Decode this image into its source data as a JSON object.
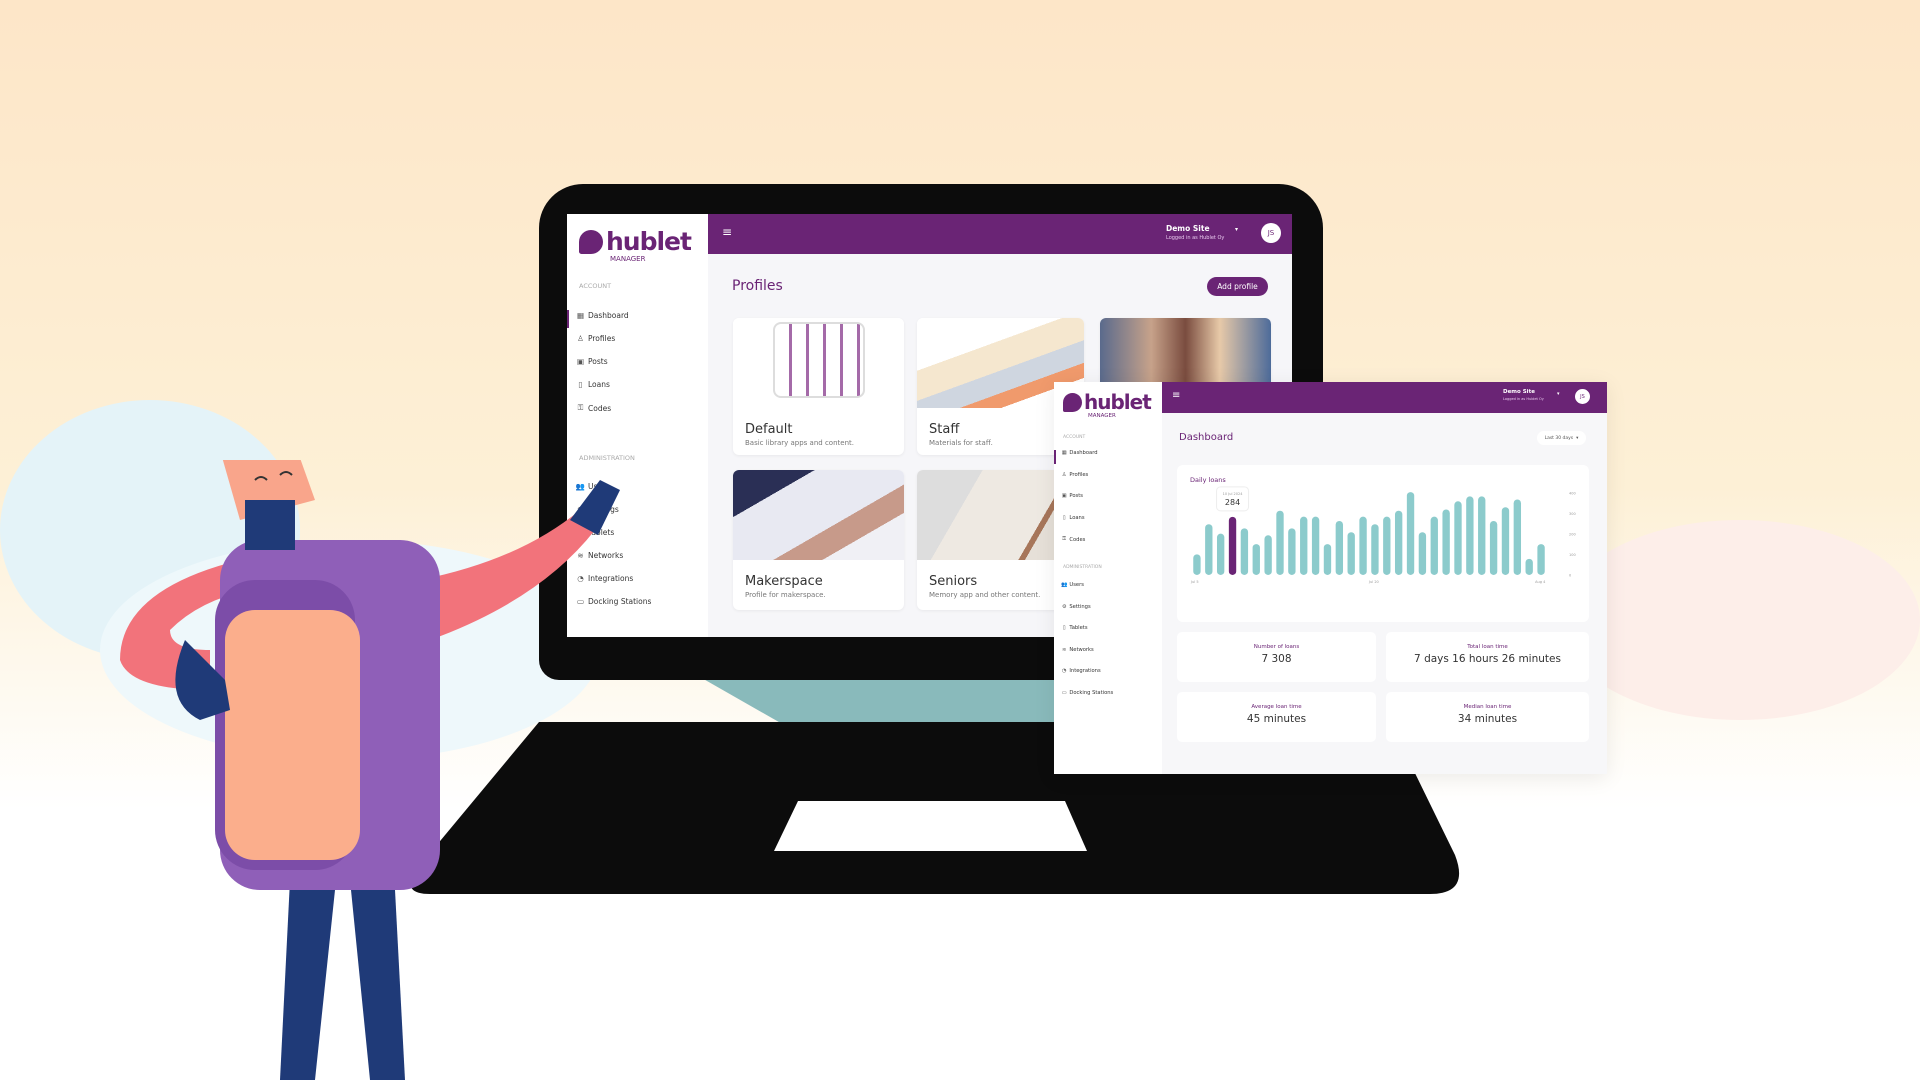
{
  "colors": {
    "brand": "#6a2475",
    "bar": "#8ccbcc",
    "highlight": "#6a2475"
  },
  "main_window": {
    "logo": {
      "name": "hublet",
      "sub": "MANAGER"
    },
    "header": {
      "menu_icon": "hamburger-icon",
      "site": "Demo Site",
      "logged_in": "Logged in as Hublet Oy",
      "avatar": "JS"
    },
    "sidebar": {
      "section_account": "ACCOUNT",
      "account_items": [
        {
          "label": "Dashboard",
          "icon": "grid"
        },
        {
          "label": "Profiles",
          "icon": "person"
        },
        {
          "label": "Posts",
          "icon": "calendar"
        },
        {
          "label": "Loans",
          "icon": "tablet-check"
        },
        {
          "label": "Codes",
          "icon": "key"
        }
      ],
      "section_admin": "ADMINISTRATION",
      "admin_items": [
        {
          "label": "Users",
          "icon": "users"
        },
        {
          "label": "Settings",
          "icon": "gear"
        },
        {
          "label": "Tablets",
          "icon": "tablet"
        },
        {
          "label": "Networks",
          "icon": "wifi"
        },
        {
          "label": "Integrations",
          "icon": "integration"
        },
        {
          "label": "Docking Stations",
          "icon": "monitor"
        }
      ],
      "active": "Profiles"
    },
    "page_title": "Profiles",
    "add_button": "Add profile",
    "profiles": [
      {
        "title": "Default",
        "desc": "Basic library apps and content."
      },
      {
        "title": "Staff",
        "desc": "Materials for staff."
      },
      {
        "title": "",
        "desc": ""
      },
      {
        "title": "Makerspace",
        "desc": "Profile for makerspace."
      },
      {
        "title": "Seniors",
        "desc": "Memory app and other content."
      }
    ]
  },
  "dashboard_window": {
    "logo": {
      "name": "hublet",
      "sub": "MANAGER"
    },
    "header": {
      "site": "Demo Site",
      "logged_in": "Logged in as Hublet Oy",
      "avatar": "JS"
    },
    "sidebar": {
      "section_account": "ACCOUNT",
      "account_items": [
        "Dashboard",
        "Profiles",
        "Posts",
        "Loans",
        "Codes"
      ],
      "section_admin": "ADMINISTRATION",
      "admin_items": [
        "Users",
        "Settings",
        "Tablets",
        "Networks",
        "Integrations",
        "Docking Stations"
      ],
      "active": "Dashboard"
    },
    "page_title": "Dashboard",
    "range_select": "Last 30 days",
    "stats": [
      {
        "label": "Number of loans",
        "value": "7 308"
      },
      {
        "label": "Total loan time",
        "value": "7 days 16 hours 26 minutes"
      },
      {
        "label": "Average loan time",
        "value": "45 minutes"
      },
      {
        "label": "Median loan time",
        "value": "34 minutes"
      }
    ]
  },
  "chart_data": {
    "type": "bar",
    "title": "Daily loans",
    "values": [
      101,
      248,
      202,
      284,
      228,
      151,
      194,
      314,
      228,
      285,
      285,
      151,
      264,
      209,
      285,
      248,
      285,
      314,
      405,
      209,
      285,
      320,
      360,
      384,
      384,
      264,
      331,
      369,
      79,
      151
    ],
    "highlight_index": 3,
    "tooltip": {
      "date": "10 Jul 2024",
      "value": "284"
    },
    "x_tick_labels": [
      "Jul 5",
      "Jul 20",
      "Aug 4"
    ],
    "y_ticks": [
      0,
      100,
      200,
      300,
      400
    ],
    "ylim": [
      0,
      420
    ],
    "y_axis_side": "right",
    "grid": false
  }
}
